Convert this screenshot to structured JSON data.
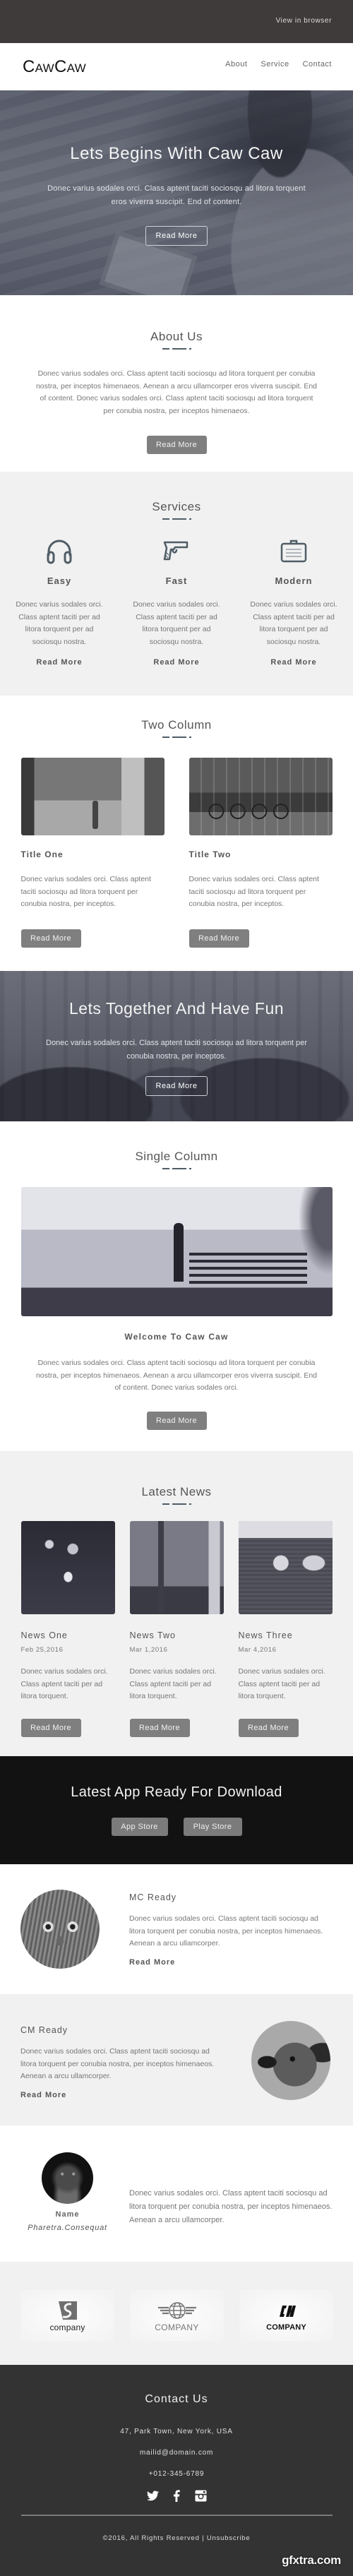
{
  "topbar": {
    "view_in_browser": "View in browser"
  },
  "header": {
    "logo": "CawCaw",
    "nav": [
      {
        "label": "About"
      },
      {
        "label": "Service"
      },
      {
        "label": "Contact"
      }
    ]
  },
  "hero": {
    "title": "Lets Begins With Caw Caw",
    "text": "Donec varius sodales orci. Class aptent taciti sociosqu ad litora torquent eros viverra suscipit. End of content.",
    "button": "Read More"
  },
  "about": {
    "title": "About Us",
    "text": "Donec varius sodales orci. Class aptent taciti sociosqu ad litora torquent per conubia nostra, per inceptos himenaeos. Aenean a arcu ullamcorper eros viverra suscipit. End of content. Donec varius sodales orci. Class aptent taciti sociosqu ad litora torquent per conubia nostra, per inceptos himenaeos.",
    "button": "Read More"
  },
  "services": {
    "title": "Services",
    "items": [
      {
        "icon": "headphones-icon",
        "title": "Easy",
        "text": "Donec varius sodales orci. Class aptent taciti per ad litora torquent per ad sociosqu nostra.",
        "link": "Read More"
      },
      {
        "icon": "pistol-icon",
        "title": "Fast",
        "text": "Donec varius sodales orci. Class aptent taciti per ad litora torquent per ad sociosqu nostra.",
        "link": "Read More"
      },
      {
        "icon": "briefcase-icon",
        "title": "Modern",
        "text": "Donec varius sodales orci. Class aptent taciti per ad litora torquent per ad sociosqu nostra.",
        "link": "Read More"
      }
    ]
  },
  "two_column": {
    "title": "Two Column",
    "items": [
      {
        "title": "Title One",
        "text": "Donec varius sodales orci. Class aptent taciti sociosqu ad litora torquent per conubia nostra, per inceptos.",
        "button": "Read More"
      },
      {
        "title": "Title Two",
        "text": "Donec varius sodales orci. Class aptent taciti sociosqu ad litora torquent per conubia nostra, per inceptos.",
        "button": "Read More"
      }
    ]
  },
  "fun": {
    "title": "Lets Together And Have Fun",
    "text": "Donec varius sodales orci. Class aptent taciti sociosqu ad litora torquent per conubia nostra, per inceptos.",
    "button": "Read More"
  },
  "single_column": {
    "title": "Single Column",
    "subtitle": "Welcome To Caw Caw",
    "text": "Donec varius sodales orci. Class aptent taciti sociosqu ad litora torquent per conubia nostra, per inceptos himenaeos. Aenean a arcu ullamcorper eros viverra suscipit. End of content. Donec varius sodales orci.",
    "button": "Read More"
  },
  "news": {
    "title": "Latest News",
    "items": [
      {
        "title": "News One",
        "date": "Feb 25,2016",
        "text": "Donec varius sodales orci. Class aptent taciti per ad litora torquent.",
        "button": "Read More"
      },
      {
        "title": "News Two",
        "date": "Mar 1,2016",
        "text": "Donec varius sodales orci. Class aptent taciti per ad litora torquent.",
        "button": "Read More"
      },
      {
        "title": "News Three",
        "date": "Mar 4,2016",
        "text": "Donec varius sodales orci. Class aptent taciti per ad litora torquent.",
        "button": "Read More"
      }
    ]
  },
  "app": {
    "title": "Latest App Ready For Download",
    "buttons": [
      {
        "label": "App Store"
      },
      {
        "label": "Play Store"
      }
    ]
  },
  "features": [
    {
      "title": "MC Ready",
      "text": "Donec varius sodales orci. Class aptent taciti sociosqu ad litora torquent per conubia nostra, per inceptos himenaeos. Aenean a arcu ullamcorper.",
      "link": "Read More"
    },
    {
      "title": "CM Ready",
      "text": "Donec varius sodales orci. Class aptent taciti sociosqu ad litora torquent per conubia nostra, per inceptos himenaeos. Aenean a arcu ullamcorper.",
      "link": "Read More"
    }
  ],
  "testimonial": {
    "name": "Name",
    "role": "Pharetra.Consequat",
    "quote": "Donec varius sodales orci. Class aptent taciti sociosqu ad litora torquent per conubia nostra, per inceptos himenaeos. Aenean a arcu ullamcorper."
  },
  "logos": [
    {
      "name": "company",
      "icon": "swan-logo-icon"
    },
    {
      "name": "COMPANY",
      "icon": "winged-globe-logo-icon"
    },
    {
      "name": "COMPANY",
      "icon": "cn-monogram-logo-icon"
    }
  ],
  "footer": {
    "title": "Contact Us",
    "address": "47, Park Town, New York, USA",
    "email": "mailid@domain.com",
    "phone": "+012-345-6789",
    "social": [
      "twitter-icon",
      "facebook-icon",
      "instagram-icon"
    ],
    "copyright": "©2016, All Rights Reserved | ",
    "unsubscribe": "Unsubscribe",
    "watermark": "gfxtra.com"
  },
  "colors": {
    "topbar_bg": "#3f3b3b",
    "light_section_bg": "#f1f1f1",
    "button_gray": "#7f7f7f",
    "icon_slate": "#4f5d66",
    "app_band_bg": "#121212",
    "footer_bg": "#333333"
  }
}
